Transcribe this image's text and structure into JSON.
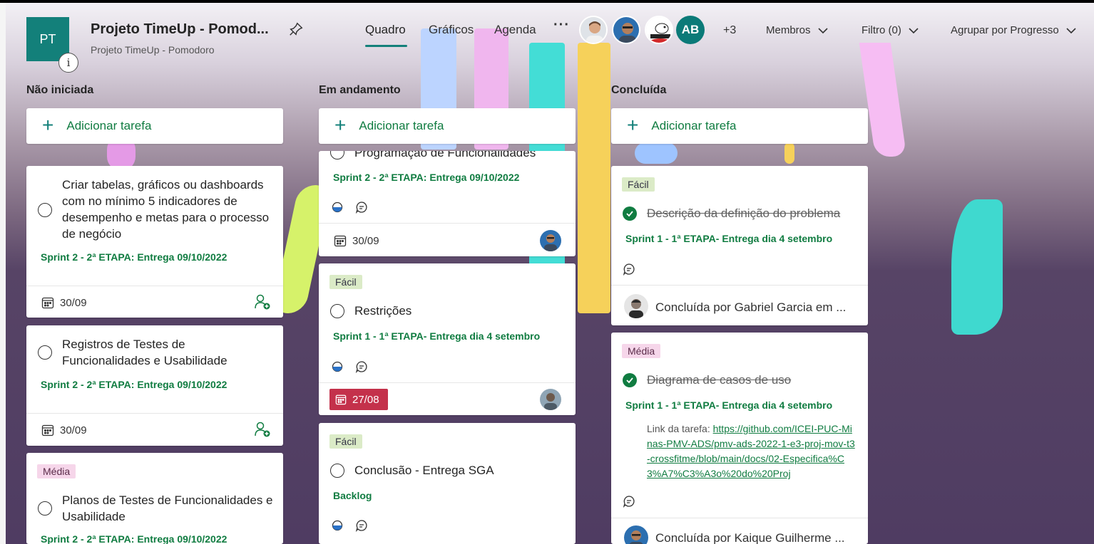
{
  "header": {
    "plan_initials": "PT",
    "info_icon": "i",
    "plan_title": "Projeto TimeUp - Pomod...",
    "plan_subtitle": "Projeto TimeUp - Pomodoro",
    "tabs": [
      {
        "label": "Quadro",
        "active": true
      },
      {
        "label": "Gráficos",
        "active": false
      },
      {
        "label": "Agenda",
        "active": false
      }
    ],
    "more": "···",
    "avatar_initials": "AB",
    "extra_members": "+3",
    "members_label": "Membros",
    "filter_label": "Filtro (0)",
    "group_label": "Agrupar por Progresso"
  },
  "columns": [
    {
      "title": "Não iniciada",
      "add_label": "Adicionar tarefa"
    },
    {
      "title": "Em andamento",
      "add_label": "Adicionar tarefa"
    },
    {
      "title": "Concluída",
      "add_label": "Adicionar tarefa"
    }
  ],
  "col1": {
    "card1": {
      "title_lines": [
        "Criar tabelas, gráficos ou dashboards",
        "com no mínimo 5 indicadores de",
        "desempenho e metas para o processo",
        "de negócio"
      ],
      "bucket": "Sprint 2 - 2ª ETAPA: Entrega 09/10/2022",
      "date": "30/09"
    },
    "card2": {
      "title_lines": [
        "Registros de Testes de",
        "Funcionalidades e Usabilidade"
      ],
      "bucket": "Sprint 2 - 2ª ETAPA: Entrega 09/10/2022",
      "date": "30/09"
    },
    "card3": {
      "label": "Média",
      "title_lines": [
        "Planos de Testes de Funcionalidades e",
        "Usabilidade"
      ],
      "bucket": "Sprint 2 - 2ª ETAPA: Entrega 09/10/2022"
    }
  },
  "col2": {
    "card1": {
      "title": "Programação de Funcionalidades",
      "bucket": "Sprint 2 - 2ª ETAPA: Entrega 09/10/2022",
      "date": "30/09"
    },
    "card2": {
      "label": "Fácil",
      "title": "Restrições",
      "bucket": "Sprint 1 - 1ª ETAPA- Entrega dia 4 setembro",
      "date": "27/08"
    },
    "card3": {
      "label": "Fácil",
      "title": "Conclusão - Entrega SGA",
      "bucket": "Backlog"
    }
  },
  "col3": {
    "card1": {
      "label": "Fácil",
      "title": "Descrição da definição do problema",
      "bucket": "Sprint 1 - 1ª ETAPA- Entrega dia 4 setembro",
      "completed_by": "Concluída por Gabriel Garcia em ..."
    },
    "card2": {
      "label": "Média",
      "title": "Diagrama de casos de uso",
      "bucket": "Sprint 1 - 1ª ETAPA- Entrega dia 4 setembro",
      "link_prefix": "Link da tarefa: ",
      "link_url": "https://github.com/ICEI-PUC-Minas-PMV-ADS/pmv-ads-2022-1-e3-proj-mov-t3-crossfitme/blob/main/docs/02-Especifica%C3%A7%C3%A3o%20do%20Proj",
      "completed_by": "Concluída por Kaique Guilherme ..."
    }
  },
  "colors": {
    "accent": "#13807a",
    "bucket_green": "#107c41",
    "late_red": "#c4314b",
    "label_facil": "#dbebc7",
    "label_media": "#f6d6ea"
  }
}
